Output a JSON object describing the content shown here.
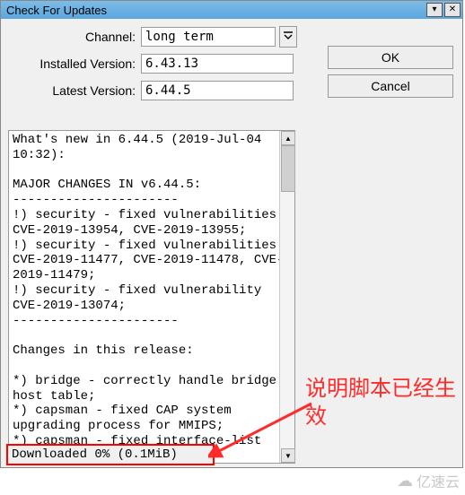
{
  "window": {
    "title": "Check For Updates"
  },
  "form": {
    "channel_label": "Channel:",
    "channel_value": "long term",
    "installed_label": "Installed Version:",
    "installed_value": "6.43.13",
    "latest_label": "Latest Version:",
    "latest_value": "6.44.5"
  },
  "buttons": {
    "ok": "OK",
    "cancel": "Cancel"
  },
  "log_text": "What's new in 6.44.5 (2019-Jul-04 10:32):\n\nMAJOR CHANGES IN v6.44.5:\n----------------------\n!) security - fixed vulnerabilities CVE-2019-13954, CVE-2019-13955;\n!) security - fixed vulnerabilities CVE-2019-11477, CVE-2019-11478, CVE-2019-11479;\n!) security - fixed vulnerability CVE-2019-13074;\n----------------------\n\nChanges in this release:\n\n*) bridge - correctly handle bridge host table;\n*) capsman - fixed CAP system upgrading process for MMIPS;\n*) capsman - fixed interface-list usage in access list;\n*) certificate - removed \"set-ca-passphrase\" parameter;\n*) cloud - properly stop \"time-zone-",
  "status": {
    "text": "Downloaded 0% (0.1MiB)"
  },
  "annotation": {
    "text": "说明脚本已经生效"
  },
  "watermark": {
    "text": "亿速云"
  }
}
